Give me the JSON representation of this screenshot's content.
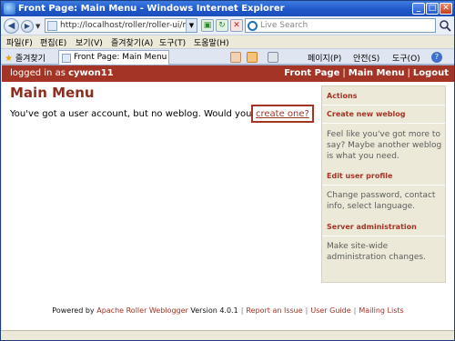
{
  "window": {
    "title": "Front Page: Main Menu - Windows Internet Explorer"
  },
  "addressbar": {
    "url": "http://localhost/roller/roller-ui/men",
    "search_placeholder": "Live Search"
  },
  "menubar": {
    "items": [
      "파일(F)",
      "편집(E)",
      "보기(V)",
      "즐겨찾기(A)",
      "도구(T)",
      "도움말(H)"
    ]
  },
  "tabs": {
    "favorites_label": "즐겨찾기",
    "active_tab": "Front Page: Main Menu"
  },
  "commandbar": {
    "page_label": "페이지(P)",
    "safety_label": "안전(S)",
    "tools_label": "도구(O)"
  },
  "roller_header": {
    "status_prefix": "logged in as",
    "username": "cywon11",
    "links": [
      "Front Page",
      "Main Menu",
      "Logout"
    ]
  },
  "main": {
    "title": "Main Menu",
    "message": "You've got a user account, but no weblog. Would you like to",
    "create_link": "create one?"
  },
  "sidebar": {
    "heading": "Actions",
    "items": [
      {
        "label": "Create new weblog",
        "description": "Feel like you've got more to say? Maybe another weblog is what you need."
      },
      {
        "label": "Edit user profile",
        "description": "Change password, contact info, select language."
      },
      {
        "label": "Server administration",
        "description": "Make site-wide administration changes."
      }
    ]
  },
  "footer": {
    "powered_by": "Powered by",
    "product": "Apache Roller Weblogger",
    "version": "Version 4.0.1",
    "links": [
      "Report an Issue",
      "User Guide",
      "Mailing Lists"
    ]
  },
  "colors": {
    "brand_red": "#a33426",
    "title_red": "#8c2d1f",
    "sidebar_bg": "#ece9d8",
    "ie_blue": "#1f55c9"
  }
}
